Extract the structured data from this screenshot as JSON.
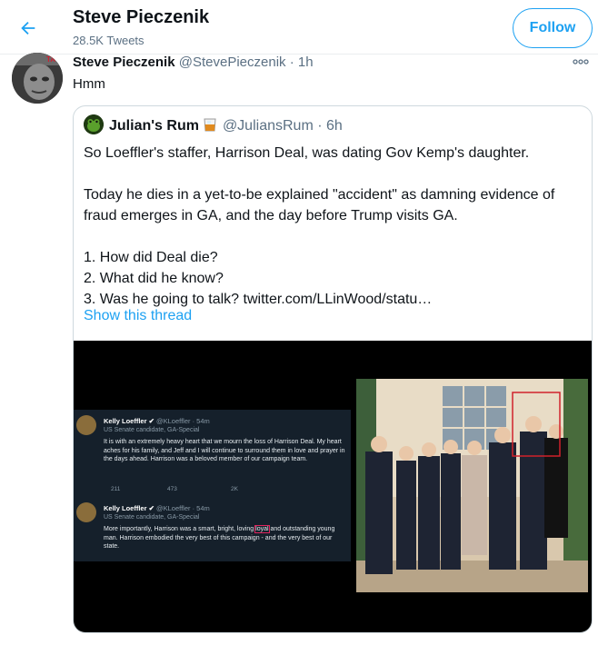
{
  "header": {
    "title": "Steve Pieczenik",
    "tweet_count": "28.5K Tweets",
    "follow_label": "Follow",
    "accent_color": "#1da1f2"
  },
  "tweet": {
    "display_name": "Steve Pieczenik",
    "meta": "@StevePieczenik · 1h",
    "text": "Hmm",
    "more_icon": "more-horizontal-icon"
  },
  "quote": {
    "display_name": "Julian's Rum",
    "meta": "@JuliansRum · 6h",
    "emoji": "whisky-glass-icon",
    "lines": [
      "So Loeffler's staffer, Harrison Deal, was dating Gov Kemp's daughter.",
      "Today he dies in a yet-to-be explained \"accident\" as damning evidence of fraud emerges in GA, and the day before Trump visits GA.",
      "1. How did Deal die?",
      "2. What did he know?",
      "3. Was he going to talk?  twitter.com/LLinWood/statu…"
    ],
    "show_thread": "Show this thread"
  },
  "media": {
    "tweet1": {
      "name": "Kelly Loeffler",
      "handle": "@KLoeffler · 54m",
      "tag": "US Senate candidate, GA-Special",
      "text": "It is with an extremely heavy heart that we mourn the loss of Harrison Deal. My heart aches for his family, and Jeff and I will continue to surround them in love and prayer in the days ahead. Harrison was a beloved member of our campaign team.",
      "replies": "211",
      "retweets": "473",
      "likes": "2K"
    },
    "tweet2": {
      "name": "Kelly Loeffler",
      "handle": "@KLoeffler · 54m",
      "tag": "US Senate candidate, GA-Special",
      "text_before": "More importantly, Harrison was a smart, bright, loving ",
      "highlight": "loyal",
      "text_after": " and outstanding young man. Harrison embodied the very best of this campaign - and the very best of our state."
    }
  }
}
